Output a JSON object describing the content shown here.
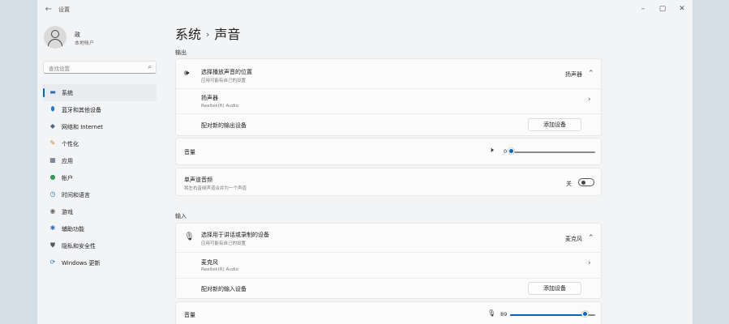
{
  "window": {
    "title": "设置",
    "back": "←",
    "minimize": "–",
    "maximize": "▢",
    "close": "✕"
  },
  "user": {
    "name": "政",
    "account_type": "本地帐户"
  },
  "search": {
    "placeholder": "查找设置"
  },
  "sidebar": {
    "items": [
      {
        "label": "系统",
        "icon": "system-icon",
        "glyph": "▬",
        "color": "#2b6cb0",
        "active": true
      },
      {
        "label": "蓝牙和其他设备",
        "icon": "bluetooth-icon",
        "glyph": "⬮",
        "color": "#1c7fd6"
      },
      {
        "label": "网络和 Internet",
        "icon": "network-icon",
        "glyph": "◆",
        "color": "#4a6a8a"
      },
      {
        "label": "个性化",
        "icon": "brush-icon",
        "glyph": "✎",
        "color": "#c7821b"
      },
      {
        "label": "应用",
        "icon": "apps-icon",
        "glyph": "▦",
        "color": "#4a5e78"
      },
      {
        "label": "帐户",
        "icon": "account-icon",
        "glyph": "●",
        "color": "#2f9e57"
      },
      {
        "label": "时间和语言",
        "icon": "clock-icon",
        "glyph": "◷",
        "color": "#2a73c5"
      },
      {
        "label": "游戏",
        "icon": "game-icon",
        "glyph": "◉",
        "color": "#6b6b6b"
      },
      {
        "label": "辅助功能",
        "icon": "accessibility-icon",
        "glyph": "✱",
        "color": "#2a6fb8"
      },
      {
        "label": "隐私和安全性",
        "icon": "shield-icon",
        "glyph": "⛊",
        "color": "#555d66"
      },
      {
        "label": "Windows 更新",
        "icon": "update-icon",
        "glyph": "⟳",
        "color": "#1f7ad3"
      }
    ]
  },
  "breadcrumb": {
    "parent": "系统",
    "separator": "›",
    "current": "声音"
  },
  "output": {
    "section_label": "输出",
    "choose_title": "选择播放声音的位置",
    "choose_sub": "应用可能有自己的设置",
    "choose_value": "扬声器",
    "device_name": "扬声器",
    "device_sub": "Realtek(R) Audio",
    "pair_label": "配对新的输出设备",
    "pair_button": "添加设备",
    "volume_label": "音量",
    "volume_value": "0",
    "volume_level": 0,
    "mono_title": "单声道音频",
    "mono_sub": "将左右音频声道合并为一个声道",
    "mono_state": "关"
  },
  "input": {
    "section_label": "输入",
    "choose_title": "选择用于讲话或录制的设备",
    "choose_sub": "应用可能有自己的设置",
    "choose_value": "麦克风",
    "device_name": "麦克风",
    "device_sub": "Realtek(R) Audio",
    "pair_label": "配对新的输入设备",
    "pair_button": "添加设备",
    "volume_label": "音量",
    "volume_value": "89",
    "volume_level": 89
  },
  "icons": {
    "chevron_up": "⌃",
    "chevron_right": "›",
    "speaker_glyph": "🕪",
    "mute_glyph": "🕨",
    "mic_glyph": "🎙",
    "search_glyph": "⌕"
  }
}
